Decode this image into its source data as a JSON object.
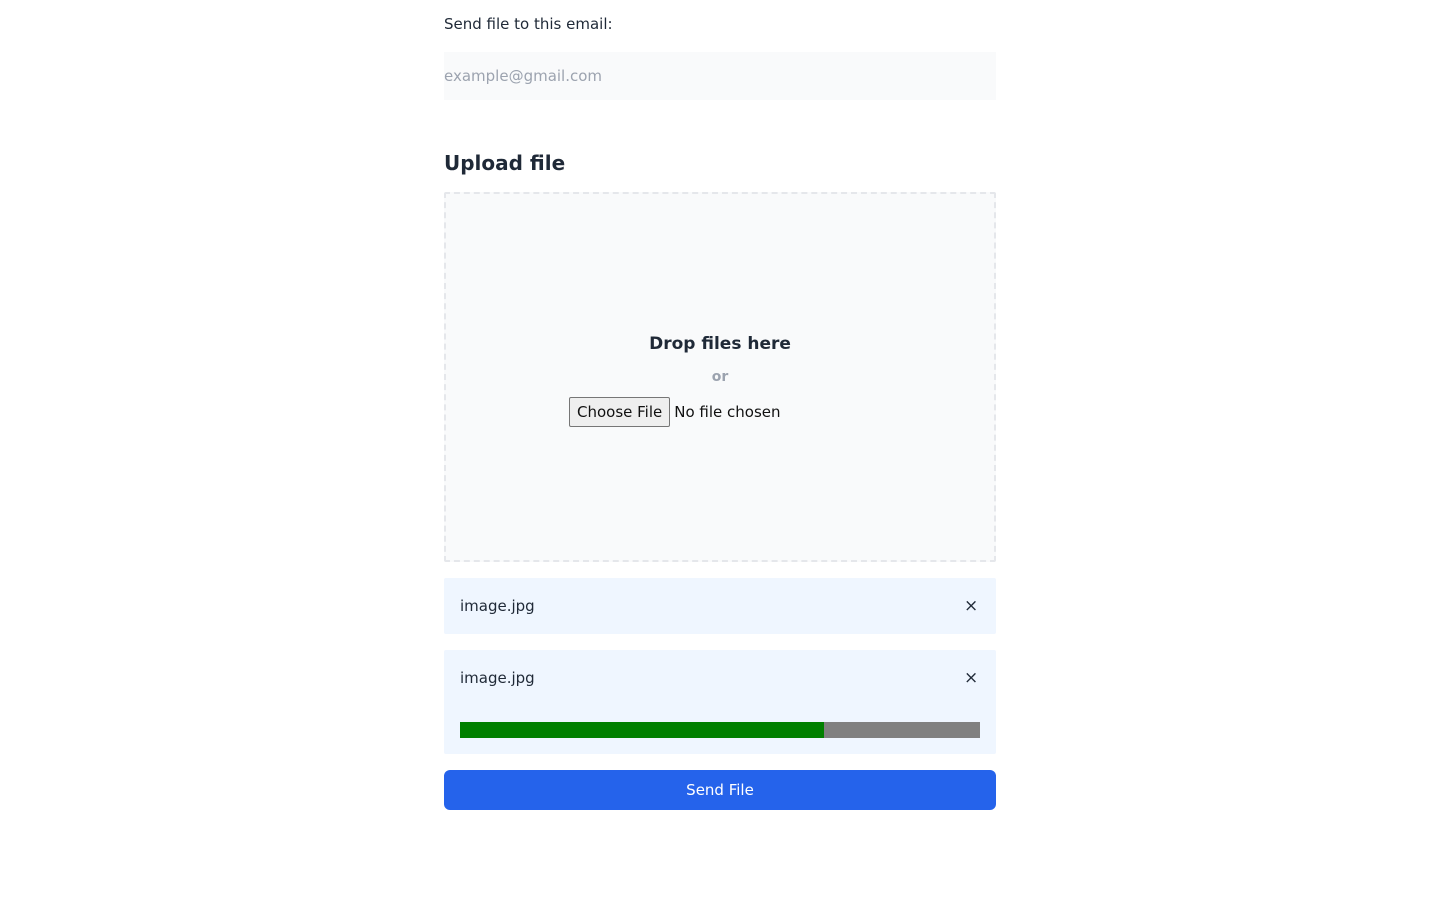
{
  "email": {
    "label": "Send file to this email:",
    "value": "",
    "placeholder": "example@gmail.com"
  },
  "upload": {
    "title": "Upload file",
    "dropzone": {
      "title": "Drop files here",
      "or_text": "or",
      "choose_button_label": "Choose File",
      "no_file_text": "No file chosen"
    }
  },
  "files": [
    {
      "name": "image.jpg",
      "remove_icon": "close-icon"
    },
    {
      "name": "image.jpg",
      "remove_icon": "close-icon",
      "progress": 0.7
    }
  ],
  "icons": {
    "remove": "×"
  },
  "colors": {
    "accent": "#2563eb",
    "progress_fill": "#008000",
    "progress_track": "#808080",
    "file_item_bg": "#eff6ff"
  },
  "actions": {
    "send_label": "Send File"
  }
}
